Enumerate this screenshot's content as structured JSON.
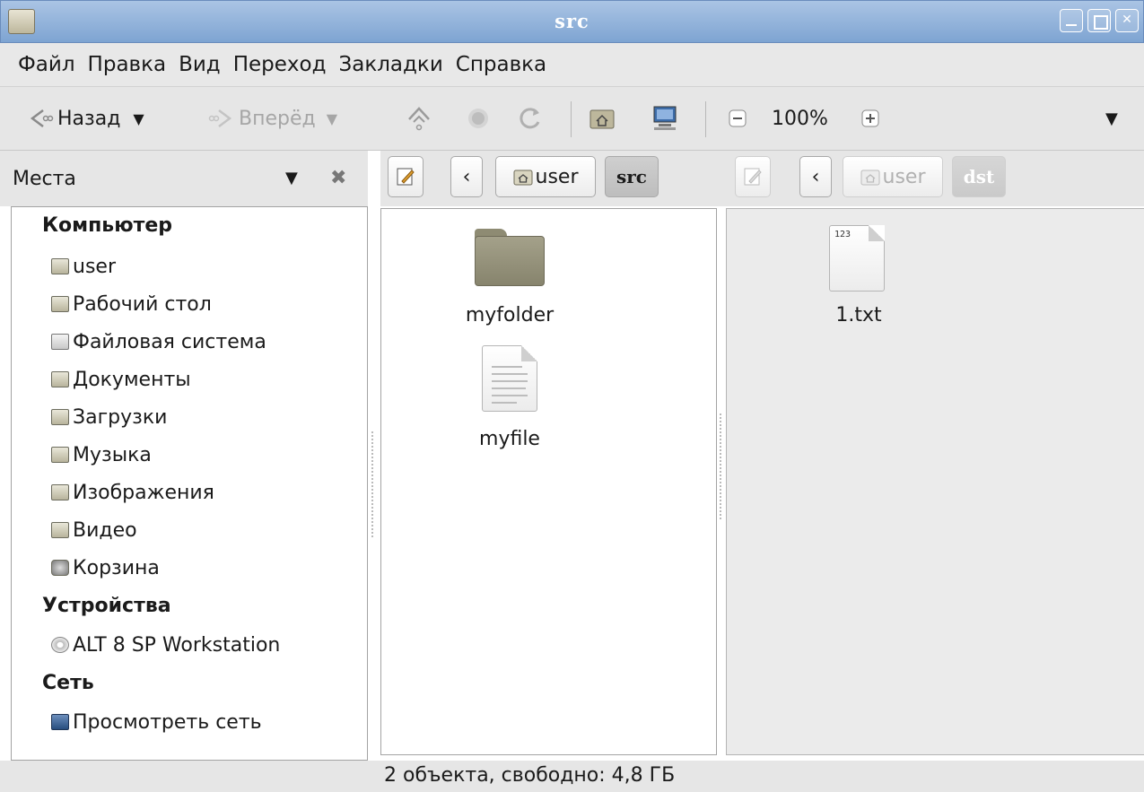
{
  "window": {
    "title": "src"
  },
  "menu": [
    "Файл",
    "Правка",
    "Вид",
    "Переход",
    "Закладки",
    "Справка"
  ],
  "toolbar": {
    "back_label": "Назад",
    "forward_label": "Вперёд",
    "zoom_level": "100%"
  },
  "places_header": {
    "label": "Места"
  },
  "path_left": {
    "crumbs": [
      "user",
      "src"
    ]
  },
  "path_right": {
    "crumbs": [
      "user",
      "dst"
    ]
  },
  "sidebar": {
    "sections": [
      {
        "heading": "Компьютер",
        "items": [
          {
            "label": "user",
            "icon": "home-folder-icon"
          },
          {
            "label": "Рабочий стол",
            "icon": "desktop-folder-icon"
          },
          {
            "label": "Файловая система",
            "icon": "filesystem-icon"
          },
          {
            "label": "Документы",
            "icon": "documents-folder-icon"
          },
          {
            "label": "Загрузки",
            "icon": "downloads-folder-icon"
          },
          {
            "label": "Музыка",
            "icon": "music-folder-icon"
          },
          {
            "label": "Изображения",
            "icon": "pictures-folder-icon"
          },
          {
            "label": "Видео",
            "icon": "videos-folder-icon"
          },
          {
            "label": "Корзина",
            "icon": "trash-icon"
          }
        ]
      },
      {
        "heading": "Устройства",
        "items": [
          {
            "label": "ALT 8 SP Workstation",
            "icon": "optical-disc-icon"
          }
        ]
      },
      {
        "heading": "Сеть",
        "items": [
          {
            "label": "Просмотреть сеть",
            "icon": "network-icon"
          }
        ]
      }
    ]
  },
  "pane_src": {
    "files": [
      {
        "name": "myfolder",
        "type": "folder"
      },
      {
        "name": "myfile",
        "type": "text"
      }
    ]
  },
  "pane_dst": {
    "files": [
      {
        "name": "1.txt",
        "type": "text",
        "badge": "123"
      }
    ]
  },
  "status": {
    "text": "2 объекта, свободно: 4,8 ГБ"
  }
}
